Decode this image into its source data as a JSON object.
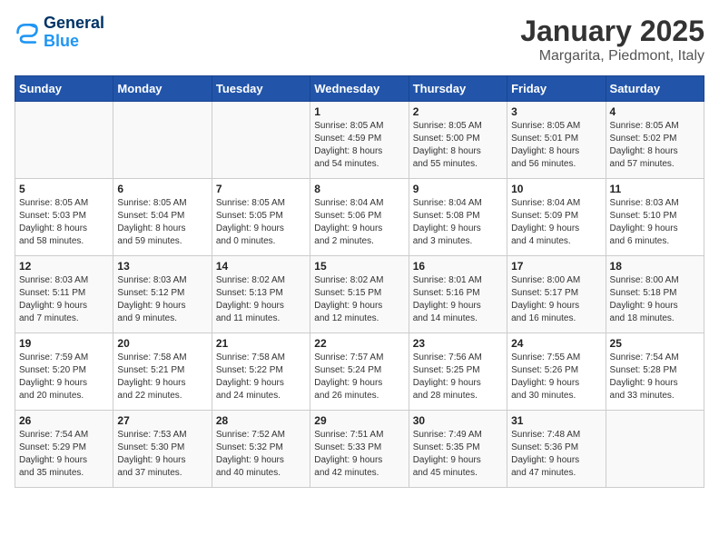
{
  "logo": {
    "line1": "General",
    "line2": "Blue"
  },
  "title": "January 2025",
  "subtitle": "Margarita, Piedmont, Italy",
  "days_of_week": [
    "Sunday",
    "Monday",
    "Tuesday",
    "Wednesday",
    "Thursday",
    "Friday",
    "Saturday"
  ],
  "weeks": [
    [
      {
        "day": "",
        "info": ""
      },
      {
        "day": "",
        "info": ""
      },
      {
        "day": "",
        "info": ""
      },
      {
        "day": "1",
        "info": "Sunrise: 8:05 AM\nSunset: 4:59 PM\nDaylight: 8 hours\nand 54 minutes."
      },
      {
        "day": "2",
        "info": "Sunrise: 8:05 AM\nSunset: 5:00 PM\nDaylight: 8 hours\nand 55 minutes."
      },
      {
        "day": "3",
        "info": "Sunrise: 8:05 AM\nSunset: 5:01 PM\nDaylight: 8 hours\nand 56 minutes."
      },
      {
        "day": "4",
        "info": "Sunrise: 8:05 AM\nSunset: 5:02 PM\nDaylight: 8 hours\nand 57 minutes."
      }
    ],
    [
      {
        "day": "5",
        "info": "Sunrise: 8:05 AM\nSunset: 5:03 PM\nDaylight: 8 hours\nand 58 minutes."
      },
      {
        "day": "6",
        "info": "Sunrise: 8:05 AM\nSunset: 5:04 PM\nDaylight: 8 hours\nand 59 minutes."
      },
      {
        "day": "7",
        "info": "Sunrise: 8:05 AM\nSunset: 5:05 PM\nDaylight: 9 hours\nand 0 minutes."
      },
      {
        "day": "8",
        "info": "Sunrise: 8:04 AM\nSunset: 5:06 PM\nDaylight: 9 hours\nand 2 minutes."
      },
      {
        "day": "9",
        "info": "Sunrise: 8:04 AM\nSunset: 5:08 PM\nDaylight: 9 hours\nand 3 minutes."
      },
      {
        "day": "10",
        "info": "Sunrise: 8:04 AM\nSunset: 5:09 PM\nDaylight: 9 hours\nand 4 minutes."
      },
      {
        "day": "11",
        "info": "Sunrise: 8:03 AM\nSunset: 5:10 PM\nDaylight: 9 hours\nand 6 minutes."
      }
    ],
    [
      {
        "day": "12",
        "info": "Sunrise: 8:03 AM\nSunset: 5:11 PM\nDaylight: 9 hours\nand 7 minutes."
      },
      {
        "day": "13",
        "info": "Sunrise: 8:03 AM\nSunset: 5:12 PM\nDaylight: 9 hours\nand 9 minutes."
      },
      {
        "day": "14",
        "info": "Sunrise: 8:02 AM\nSunset: 5:13 PM\nDaylight: 9 hours\nand 11 minutes."
      },
      {
        "day": "15",
        "info": "Sunrise: 8:02 AM\nSunset: 5:15 PM\nDaylight: 9 hours\nand 12 minutes."
      },
      {
        "day": "16",
        "info": "Sunrise: 8:01 AM\nSunset: 5:16 PM\nDaylight: 9 hours\nand 14 minutes."
      },
      {
        "day": "17",
        "info": "Sunrise: 8:00 AM\nSunset: 5:17 PM\nDaylight: 9 hours\nand 16 minutes."
      },
      {
        "day": "18",
        "info": "Sunrise: 8:00 AM\nSunset: 5:18 PM\nDaylight: 9 hours\nand 18 minutes."
      }
    ],
    [
      {
        "day": "19",
        "info": "Sunrise: 7:59 AM\nSunset: 5:20 PM\nDaylight: 9 hours\nand 20 minutes."
      },
      {
        "day": "20",
        "info": "Sunrise: 7:58 AM\nSunset: 5:21 PM\nDaylight: 9 hours\nand 22 minutes."
      },
      {
        "day": "21",
        "info": "Sunrise: 7:58 AM\nSunset: 5:22 PM\nDaylight: 9 hours\nand 24 minutes."
      },
      {
        "day": "22",
        "info": "Sunrise: 7:57 AM\nSunset: 5:24 PM\nDaylight: 9 hours\nand 26 minutes."
      },
      {
        "day": "23",
        "info": "Sunrise: 7:56 AM\nSunset: 5:25 PM\nDaylight: 9 hours\nand 28 minutes."
      },
      {
        "day": "24",
        "info": "Sunrise: 7:55 AM\nSunset: 5:26 PM\nDaylight: 9 hours\nand 30 minutes."
      },
      {
        "day": "25",
        "info": "Sunrise: 7:54 AM\nSunset: 5:28 PM\nDaylight: 9 hours\nand 33 minutes."
      }
    ],
    [
      {
        "day": "26",
        "info": "Sunrise: 7:54 AM\nSunset: 5:29 PM\nDaylight: 9 hours\nand 35 minutes."
      },
      {
        "day": "27",
        "info": "Sunrise: 7:53 AM\nSunset: 5:30 PM\nDaylight: 9 hours\nand 37 minutes."
      },
      {
        "day": "28",
        "info": "Sunrise: 7:52 AM\nSunset: 5:32 PM\nDaylight: 9 hours\nand 40 minutes."
      },
      {
        "day": "29",
        "info": "Sunrise: 7:51 AM\nSunset: 5:33 PM\nDaylight: 9 hours\nand 42 minutes."
      },
      {
        "day": "30",
        "info": "Sunrise: 7:49 AM\nSunset: 5:35 PM\nDaylight: 9 hours\nand 45 minutes."
      },
      {
        "day": "31",
        "info": "Sunrise: 7:48 AM\nSunset: 5:36 PM\nDaylight: 9 hours\nand 47 minutes."
      },
      {
        "day": "",
        "info": ""
      }
    ]
  ]
}
